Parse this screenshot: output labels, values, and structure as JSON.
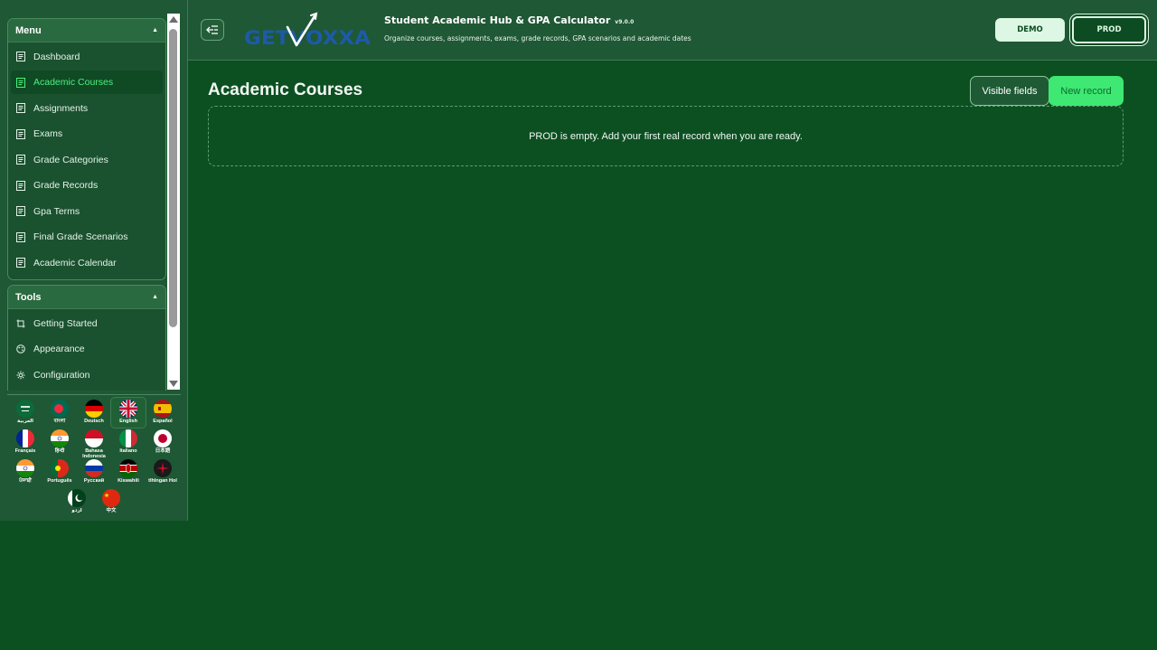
{
  "sidebar": {
    "menu": {
      "title": "Menu",
      "items": [
        {
          "label": "Dashboard"
        },
        {
          "label": "Academic Courses"
        },
        {
          "label": "Assignments"
        },
        {
          "label": "Exams"
        },
        {
          "label": "Grade Categories"
        },
        {
          "label": "Grade Records"
        },
        {
          "label": "Gpa Terms"
        },
        {
          "label": "Final Grade Scenarios"
        },
        {
          "label": "Academic Calendar"
        }
      ]
    },
    "tools": {
      "title": "Tools",
      "items": [
        {
          "label": "Getting Started",
          "icon": "crop-icon"
        },
        {
          "label": "Appearance",
          "icon": "palette-icon"
        },
        {
          "label": "Configuration",
          "icon": "gear-icon"
        }
      ]
    },
    "languages": [
      {
        "label": "العربية",
        "flag": "flag-saudi-arabia-icon"
      },
      {
        "label": "বাংলা",
        "flag": "flag-bangladesh-icon"
      },
      {
        "label": "Deutsch",
        "flag": "flag-germany-icon"
      },
      {
        "label": "English",
        "flag": "flag-uk-icon",
        "selected": true
      },
      {
        "label": "Español",
        "flag": "flag-spain-icon"
      },
      {
        "label": "Français",
        "flag": "flag-france-icon"
      },
      {
        "label": "हिन्दी",
        "flag": "flag-india-icon"
      },
      {
        "label": "Bahasa Indonesia",
        "flag": "flag-indonesia-icon"
      },
      {
        "label": "Italiano",
        "flag": "flag-italy-icon"
      },
      {
        "label": "日本語",
        "flag": "flag-japan-icon"
      },
      {
        "label": "ਪੰਜਾਬੀ",
        "flag": "flag-india-icon"
      },
      {
        "label": "Português",
        "flag": "flag-portugal-icon"
      },
      {
        "label": "Русский",
        "flag": "flag-russia-icon"
      },
      {
        "label": "Kiswahili",
        "flag": "flag-kenya-icon"
      },
      {
        "label": "tlhIngan Hol",
        "flag": "flag-klingon-icon"
      },
      {
        "label": "اردو",
        "flag": "flag-pakistan-icon"
      },
      {
        "label": "中文",
        "flag": "flag-china-icon"
      }
    ]
  },
  "header": {
    "logo_text": "GETVOXXA",
    "title": "Student Academic Hub & GPA Calculator",
    "version": "v9.0.0",
    "subtitle": "Organize courses, assignments, exams, grade records, GPA scenarios and academic dates",
    "demo_label": "DEMO",
    "prod_label": "PROD",
    "active_env": "PROD"
  },
  "main": {
    "title": "Academic Courses",
    "visible_fields_label": "Visible fields",
    "new_record_label": "New record",
    "empty_message": "PROD is empty. Add your first real record when you are ready."
  },
  "colors": {
    "background": "#0c5022",
    "sidebar": "#1f5834",
    "accent_green": "#3ee872",
    "active_text": "#4cf07c",
    "logo_blue": "#1d5aa8"
  }
}
